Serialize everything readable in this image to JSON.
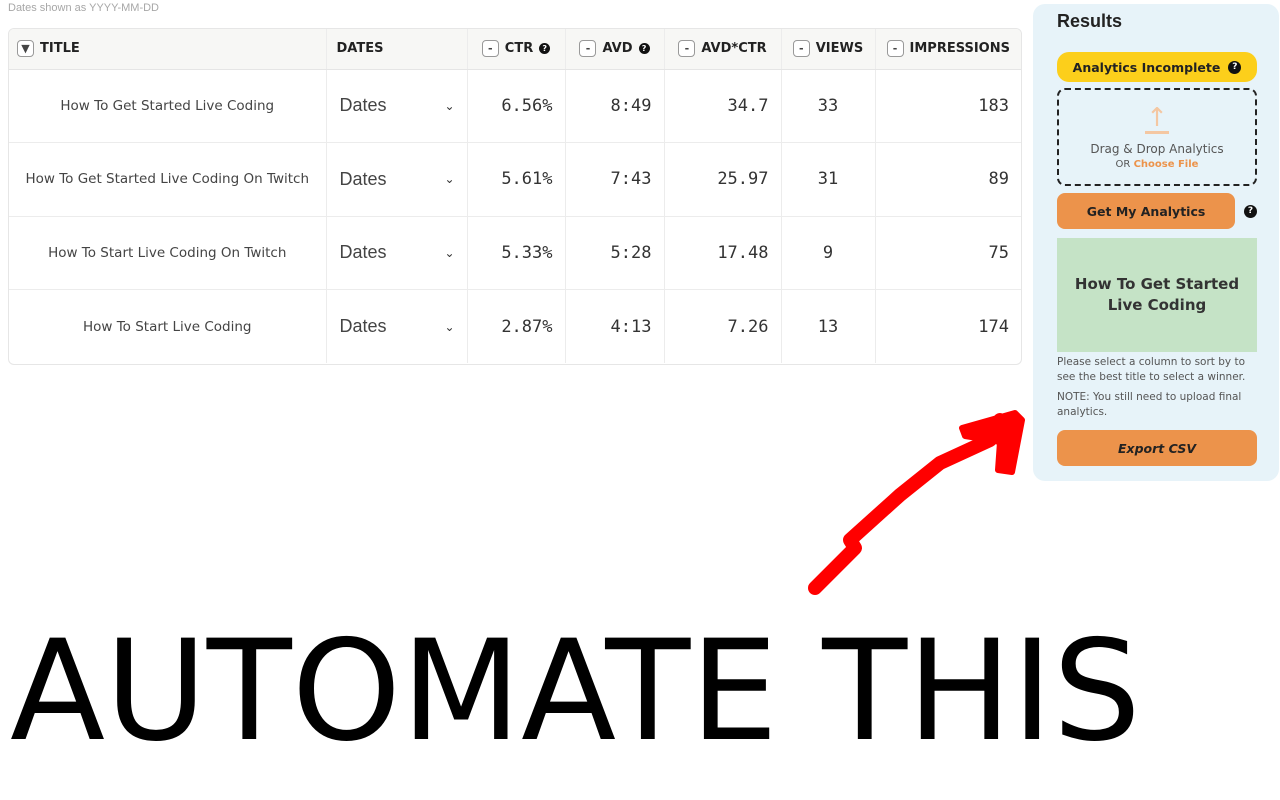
{
  "dates_note": "Dates shown as YYYY-MM-DD",
  "table": {
    "headers": {
      "title": "TITLE",
      "dates": "DATES",
      "ctr": "CTR",
      "avd": "AVD",
      "avd_ctr": "AVD*CTR",
      "views": "VIEWS",
      "impressions": "IMPRESSIONS"
    },
    "title_toggle": "▼",
    "minus": "-",
    "help": "?",
    "rows": [
      {
        "title": "How To Get Started Live Coding",
        "dates": "Dates",
        "ctr": "6.56%",
        "avd": "8:49",
        "avd_ctr": "34.7",
        "views": "33",
        "impressions": "183"
      },
      {
        "title": "How To Get Started Live Coding On Twitch",
        "dates": "Dates",
        "ctr": "5.61%",
        "avd": "7:43",
        "avd_ctr": "25.97",
        "views": "31",
        "impressions": "89"
      },
      {
        "title": "How To Start Live Coding On Twitch",
        "dates": "Dates",
        "ctr": "5.33%",
        "avd": "5:28",
        "avd_ctr": "17.48",
        "views": "9",
        "impressions": "75"
      },
      {
        "title": "How To Start Live Coding",
        "dates": "Dates",
        "ctr": "2.87%",
        "avd": "4:13",
        "avd_ctr": "7.26",
        "views": "13",
        "impressions": "174"
      }
    ]
  },
  "results": {
    "heading": "Results",
    "status": "Analytics Incomplete",
    "dropzone_text": "Drag & Drop Analytics",
    "dropzone_or": "OR",
    "choose_file": "Choose File",
    "get_button": "Get My Analytics",
    "winner_title": "How To Get Started Live Coding",
    "hint": "Please select a column to sort by to see the best title to select a winner.",
    "note": "NOTE: You still need to upload final analytics.",
    "export_button": "Export CSV"
  },
  "overlay": {
    "caption": "AUTOMATE THIS"
  },
  "colors": {
    "results_bg": "#e7f3f9",
    "status_yellow": "#fccf1b",
    "accent_orange": "#ec934b",
    "winner_green": "#c5e3c6",
    "arrow_red": "#ff0000"
  },
  "icons": {
    "chevron": "chevron-down-icon",
    "upload": "upload-arrow-icon",
    "help": "question-circle-icon"
  }
}
